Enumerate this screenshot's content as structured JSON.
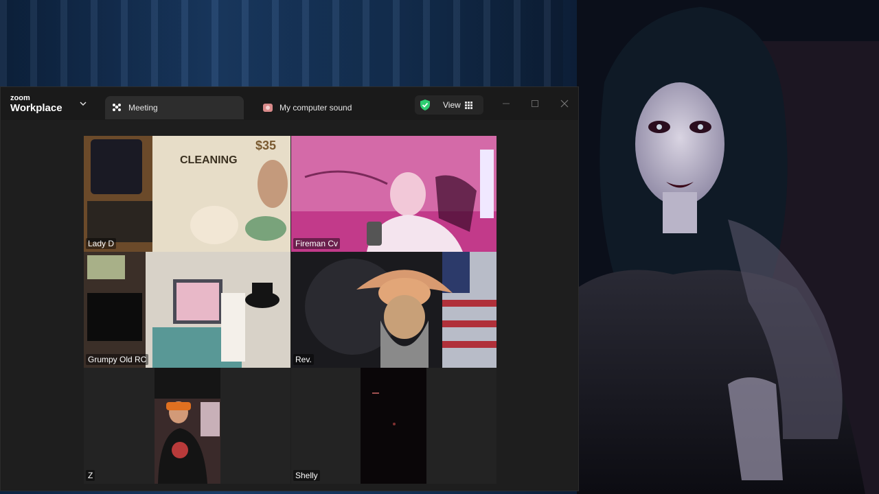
{
  "app": {
    "logo_top": "zoom",
    "logo_bottom": "Workplace"
  },
  "tabs": [
    {
      "label": "Meeting",
      "icon": "participants-icon",
      "active": true
    },
    {
      "label": "My computer sound",
      "icon": "computer-sound-icon",
      "active": false
    }
  ],
  "security": {
    "icon": "shield-check-icon",
    "color": "#2ecc71"
  },
  "view_button": {
    "label": "View",
    "icon": "grid-icon"
  },
  "window_controls": [
    "minimize-icon",
    "maximize-icon",
    "close-icon"
  ],
  "participants": [
    {
      "name": "Lady D",
      "speaking": true
    },
    {
      "name": "Fireman Cv",
      "speaking": false
    },
    {
      "name": "Grumpy Old RC",
      "speaking": false
    },
    {
      "name": "Rev.",
      "speaking": false
    },
    {
      "name": "Z",
      "speaking": false
    },
    {
      "name": "Shelly",
      "speaking": false
    }
  ],
  "colors": {
    "speaking_outline": "#38d16a",
    "window_bg": "#1e1e1e",
    "titlebar_bg": "#1a1a1a"
  }
}
